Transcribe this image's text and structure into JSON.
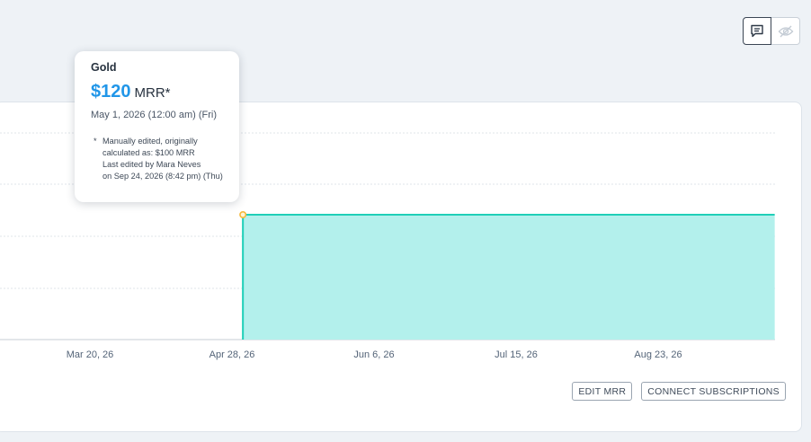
{
  "toolbar": {
    "buttons": [
      {
        "icon": "comment-icon",
        "active": true
      },
      {
        "icon": "eye-off-icon",
        "active": false
      }
    ]
  },
  "tooltip": {
    "title": "Gold",
    "value": "$120",
    "unit": "MRR*",
    "date": "May 1, 2026 (12:00 am) (Fri)",
    "note_star": "*",
    "note_lines": [
      "Manually edited, originally",
      "calculated as: $100 MRR",
      "Last edited by Mara Neves",
      "on Sep 24, 2026 (8:42 pm) (Thu)"
    ]
  },
  "chart_data": {
    "type": "area",
    "x_tick_labels": [
      "Mar 20, 26",
      "Apr 28, 26",
      "Jun 6, 26",
      "Jul 15, 26",
      "Aug 23, 26"
    ],
    "series": [
      {
        "x": [
          "May 1, 2026",
          "Sep 24, 2026"
        ],
        "values": [
          120,
          120
        ]
      }
    ],
    "colors": {
      "line": "#1fcfb8",
      "fill": "#b3f0ec",
      "point": "#f6b93b"
    },
    "grid": true
  },
  "actions": {
    "edit_label": "EDIT MRR",
    "connect_label": "CONNECT SUBSCRIPTIONS"
  }
}
